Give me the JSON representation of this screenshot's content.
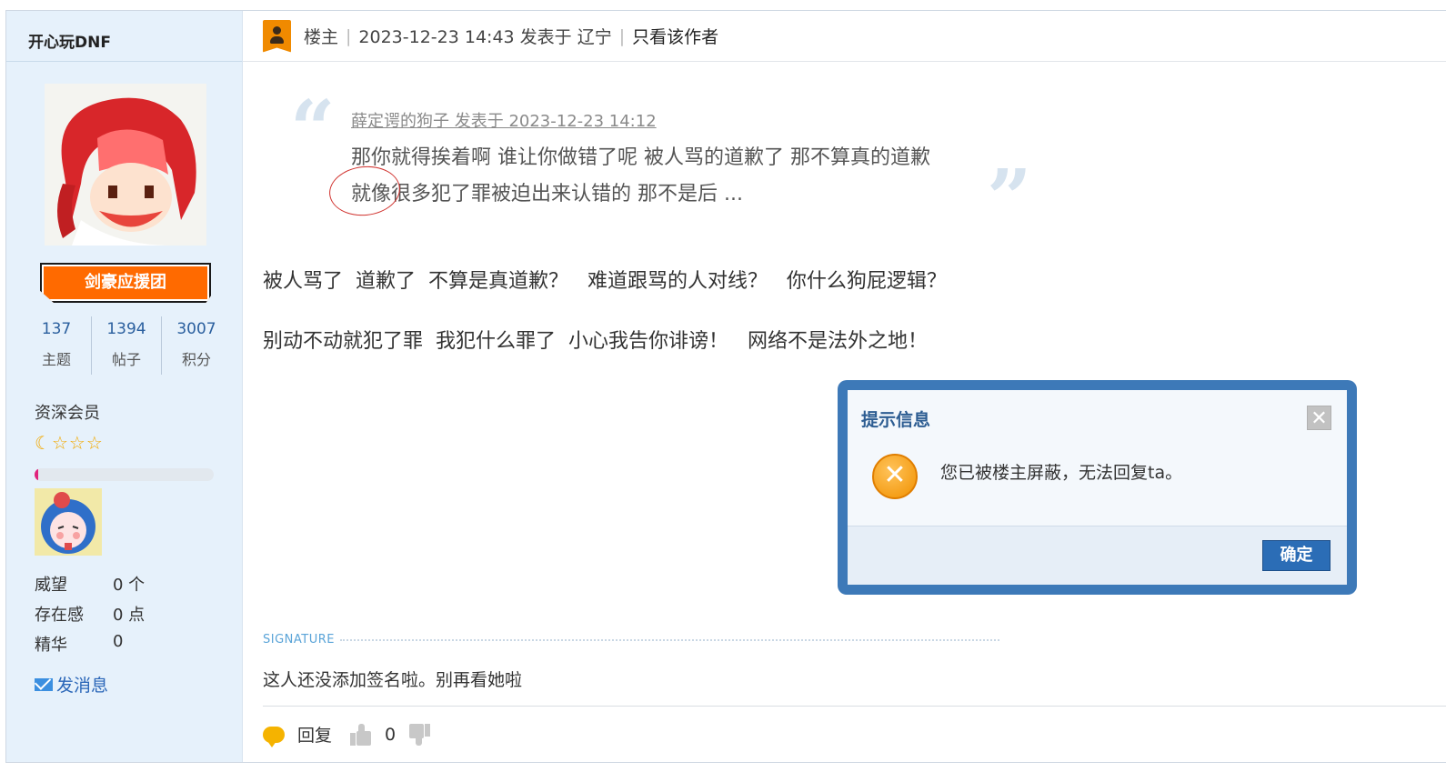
{
  "author": {
    "name": "开心玩DNF",
    "group_badge": "剑豪应援团",
    "stats": [
      {
        "value": "137",
        "label": "主题"
      },
      {
        "value": "1394",
        "label": "帖子"
      },
      {
        "value": "3007",
        "label": "积分"
      }
    ],
    "rank_title": "资深会员",
    "level_progress": 0.02,
    "profile": [
      {
        "key": "威望",
        "value": "0 个"
      },
      {
        "key": "存在感",
        "value": "0 点"
      },
      {
        "key": "精华",
        "value": "0"
      }
    ],
    "send_message": "发消息"
  },
  "post": {
    "floor": "楼主",
    "posted_at": "2023-12-23 14:43 发表于 辽宁",
    "only_author": "只看该作者",
    "quote": {
      "meta": "薛定谔的狗子 发表于 2023-12-23 14:12",
      "line1": "那你就得挨着啊 谁让你做错了呢 被人骂的道歉了 那不算真的道歉",
      "line2": "就像很多犯了罪被迫出来认错的 那不是后 ..."
    },
    "paragraphs": [
      "被人骂了  道歉了  不算是真道歉？   难道跟骂的人对线？   你什么狗屁逻辑？",
      "别动不动就犯了罪  我犯什么罪了  小心我告你诽谤！   网络不是法外之地！"
    ],
    "signature_label": "SIGNATURE",
    "signature": "这人还没添加签名啦。别再看她啦",
    "reply_label": "回复",
    "like_count": "0"
  },
  "dialog": {
    "title": "提示信息",
    "close_glyph": "✕",
    "error_glyph": "✕",
    "message": "您已被楼主屏蔽，无法回复ta。",
    "ok_label": "确定"
  },
  "colors": {
    "sidebar_bg": "#e6f1fb",
    "badge_orange": "#ff6a00",
    "link_blue": "#2a66b8",
    "dialog_border": "#3d79b8",
    "ok_button": "#2b6db6"
  }
}
